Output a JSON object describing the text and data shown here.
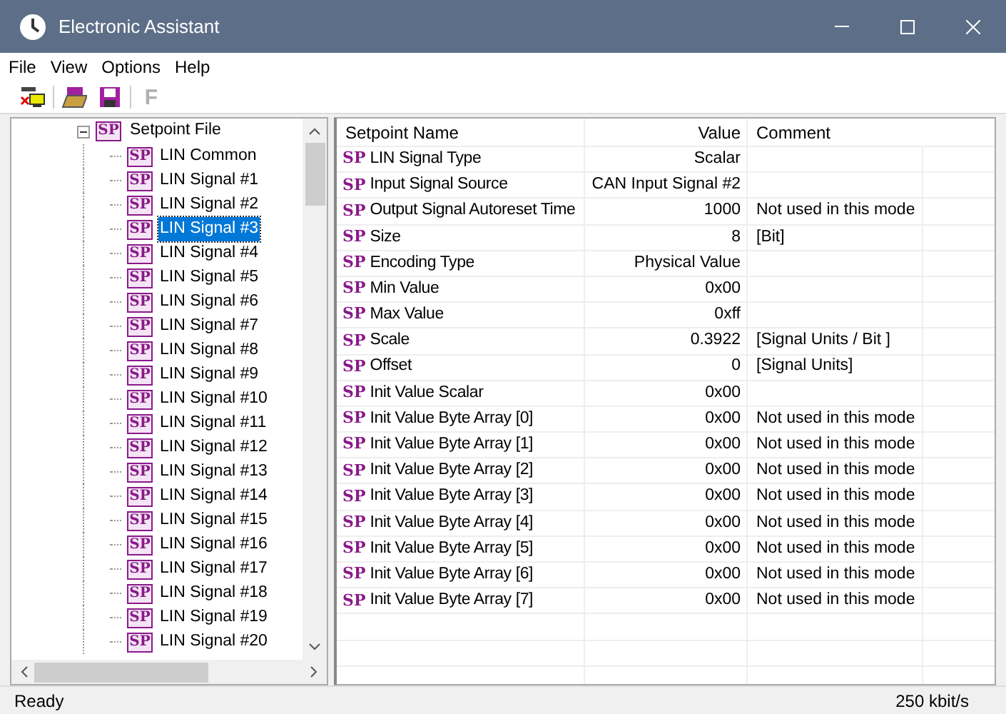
{
  "window": {
    "title": "Electronic Assistant"
  },
  "menu": [
    "File",
    "View",
    "Options",
    "Help"
  ],
  "toolbar": [
    {
      "kind": "connect"
    },
    {
      "kind": "open"
    },
    {
      "kind": "save"
    },
    {
      "kind": "letter",
      "label": "F",
      "disabled": true
    }
  ],
  "tree": {
    "label": "Setpoint File",
    "icon_text": "SP",
    "expanded": true,
    "children": [
      {
        "label": "LIN Common",
        "icon_text": "SP",
        "selected": false
      },
      {
        "label": "LIN Signal #1",
        "icon_text": "SP",
        "selected": false
      },
      {
        "label": "LIN Signal #2",
        "icon_text": "SP",
        "selected": false
      },
      {
        "label": "LIN Signal #3",
        "icon_text": "SP",
        "selected": true
      },
      {
        "label": "LIN Signal #4",
        "icon_text": "SP",
        "selected": false
      },
      {
        "label": "LIN Signal #5",
        "icon_text": "SP",
        "selected": false
      },
      {
        "label": "LIN Signal #6",
        "icon_text": "SP",
        "selected": false
      },
      {
        "label": "LIN Signal #7",
        "icon_text": "SP",
        "selected": false
      },
      {
        "label": "LIN Signal #8",
        "icon_text": "SP",
        "selected": false
      },
      {
        "label": "LIN Signal #9",
        "icon_text": "SP",
        "selected": false
      },
      {
        "label": "LIN Signal #10",
        "icon_text": "SP",
        "selected": false
      },
      {
        "label": "LIN Signal #11",
        "icon_text": "SP",
        "selected": false
      },
      {
        "label": "LIN Signal #12",
        "icon_text": "SP",
        "selected": false
      },
      {
        "label": "LIN Signal #13",
        "icon_text": "SP",
        "selected": false
      },
      {
        "label": "LIN Signal #14",
        "icon_text": "SP",
        "selected": false
      },
      {
        "label": "LIN Signal #15",
        "icon_text": "SP",
        "selected": false
      },
      {
        "label": "LIN Signal #16",
        "icon_text": "SP",
        "selected": false
      },
      {
        "label": "LIN Signal #17",
        "icon_text": "SP",
        "selected": false
      },
      {
        "label": "LIN Signal #18",
        "icon_text": "SP",
        "selected": false
      },
      {
        "label": "LIN Signal #19",
        "icon_text": "SP",
        "selected": false
      },
      {
        "label": "LIN Signal #20",
        "icon_text": "SP",
        "selected": false
      }
    ]
  },
  "table": {
    "columns": [
      "Setpoint Name",
      "Value",
      "Comment"
    ],
    "rows": [
      {
        "badge": "SP",
        "name": "LIN Signal Type",
        "value": "Scalar",
        "comment": ""
      },
      {
        "badge": "SP",
        "name": "Input Signal Source",
        "value": "CAN Input Signal #2",
        "comment": ""
      },
      {
        "badge": "SP",
        "name": "Output Signal Autoreset Time",
        "value": "1000",
        "comment": "Not used in this mode"
      },
      {
        "badge": "SP",
        "name": "Size",
        "value": "8",
        "comment": "[Bit]"
      },
      {
        "badge": "SP",
        "name": "Encoding Type",
        "value": "Physical Value",
        "comment": ""
      },
      {
        "badge": "SP",
        "name": "Min Value",
        "value": "0x00",
        "comment": ""
      },
      {
        "badge": "SP",
        "name": "Max Value",
        "value": "0xff",
        "comment": ""
      },
      {
        "badge": "SP",
        "name": "Scale",
        "value": "0.3922",
        "comment": "[Signal Units / Bit ]"
      },
      {
        "badge": "SP",
        "name": "Offset",
        "value": "0",
        "comment": "[Signal Units]"
      },
      {
        "badge": "SP",
        "name": "Init Value Scalar",
        "value": "0x00",
        "comment": ""
      },
      {
        "badge": "SP",
        "name": "Init Value Byte Array [0]",
        "value": "0x00",
        "comment": "Not used in this mode"
      },
      {
        "badge": "SP",
        "name": "Init Value Byte Array [1]",
        "value": "0x00",
        "comment": "Not used in this mode"
      },
      {
        "badge": "SP",
        "name": "Init Value Byte Array [2]",
        "value": "0x00",
        "comment": "Not used in this mode"
      },
      {
        "badge": "SP",
        "name": "Init Value Byte Array [3]",
        "value": "0x00",
        "comment": "Not used in this mode"
      },
      {
        "badge": "SP",
        "name": "Init Value Byte Array [4]",
        "value": "0x00",
        "comment": "Not used in this mode"
      },
      {
        "badge": "SP",
        "name": "Init Value Byte Array [5]",
        "value": "0x00",
        "comment": "Not used in this mode"
      },
      {
        "badge": "SP",
        "name": "Init Value Byte Array [6]",
        "value": "0x00",
        "comment": "Not used in this mode"
      },
      {
        "badge": "SP",
        "name": "Init Value Byte Array [7]",
        "value": "0x00",
        "comment": "Not used in this mode"
      }
    ]
  },
  "status_bar": {
    "message": "Ready",
    "speed": "250 kbit/s"
  }
}
